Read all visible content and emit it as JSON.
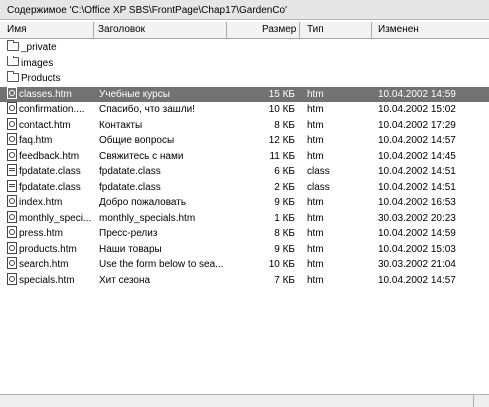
{
  "window": {
    "title": "Содержимое 'C:\\Office XP SBS\\FrontPage\\Chap17\\GardenCo'"
  },
  "columns": [
    "Имя",
    "Заголовок",
    "Размер",
    "Тип",
    "Изменен"
  ],
  "folders": [
    {
      "name": "_private",
      "icon": "folder-icon"
    },
    {
      "name": "images",
      "icon": "folder-icon"
    },
    {
      "name": "Products",
      "icon": "folder-icon"
    }
  ],
  "files": [
    {
      "name": "classes.htm",
      "title": "Учебные курсы",
      "size": "15 КБ",
      "type": "htm",
      "modified": "10.04.2002 14:59",
      "icon": "web-page-icon",
      "selected": true
    },
    {
      "name": "confirmation....",
      "title": "Спасибо, что зашли!",
      "size": "10 КБ",
      "type": "htm",
      "modified": "10.04.2002 15:02",
      "icon": "web-page-icon",
      "selected": false
    },
    {
      "name": "contact.htm",
      "title": "Контакты",
      "size": "8 КБ",
      "type": "htm",
      "modified": "10.04.2002 17:29",
      "icon": "web-page-icon",
      "selected": false
    },
    {
      "name": "faq.htm",
      "title": "Общие вопросы",
      "size": "12 КБ",
      "type": "htm",
      "modified": "10.04.2002 14:57",
      "icon": "web-page-icon",
      "selected": false
    },
    {
      "name": "feedback.htm",
      "title": "Свяжитесь с нами",
      "size": "11 КБ",
      "type": "htm",
      "modified": "10.04.2002 14:45",
      "icon": "web-page-icon",
      "selected": false
    },
    {
      "name": "fpdatate.class",
      "title": "fpdatate.class",
      "size": "6 КБ",
      "type": "class",
      "modified": "10.04.2002 14:51",
      "icon": "class-file-icon",
      "selected": false
    },
    {
      "name": "fpdatate.class",
      "title": "fpdatate.class",
      "size": "2 КБ",
      "type": "class",
      "modified": "10.04.2002 14:51",
      "icon": "class-file-icon",
      "selected": false
    },
    {
      "name": "index.htm",
      "title": "Добро пожаловать",
      "size": "9 КБ",
      "type": "htm",
      "modified": "10.04.2002 16:53",
      "icon": "web-page-icon",
      "selected": false
    },
    {
      "name": "monthly_speci...",
      "title": "monthly_specials.htm",
      "size": "1 КБ",
      "type": "htm",
      "modified": "30.03.2002 20:23",
      "icon": "web-page-icon",
      "selected": false
    },
    {
      "name": "press.htm",
      "title": "Пресс-релиз",
      "size": "8 КБ",
      "type": "htm",
      "modified": "10.04.2002 14:59",
      "icon": "web-page-icon",
      "selected": false
    },
    {
      "name": "products.htm",
      "title": "Наши товары",
      "size": "9 КБ",
      "type": "htm",
      "modified": "10.04.2002 15:03",
      "icon": "web-page-icon",
      "selected": false
    },
    {
      "name": "search.htm",
      "title": "Use the form below to sea...",
      "size": "10 КБ",
      "type": "htm",
      "modified": "30.03.2002 21:04",
      "icon": "web-page-icon",
      "selected": false
    },
    {
      "name": "specials.htm",
      "title": "Хит сезона",
      "size": "7 КБ",
      "type": "htm",
      "modified": "10.04.2002 14:57",
      "icon": "web-page-icon",
      "selected": false
    }
  ],
  "colors": {
    "selection": "#727272",
    "header_bg": "#f3f3f3",
    "titlebar_bg": "#e6e6e6"
  }
}
